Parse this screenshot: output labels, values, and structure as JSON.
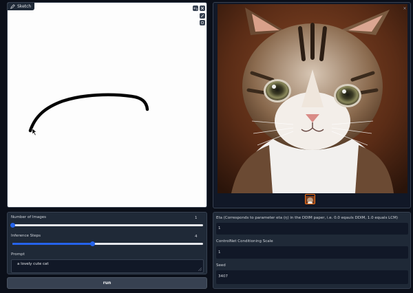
{
  "sketch": {
    "label": "Sketch"
  },
  "output": {
    "image_description": "cat-photo",
    "thumbnail": "cat-thumbnail"
  },
  "controls": {
    "num_images": {
      "label": "Number of Images",
      "value": "1",
      "fraction": 0.0
    },
    "inference_steps": {
      "label": "Inference Steps",
      "value": "4",
      "fraction": 0.42
    },
    "prompt": {
      "label": "Prompt",
      "value": "a lovely cute cat"
    }
  },
  "run_button": {
    "label": "run"
  },
  "right_controls": {
    "eta": {
      "label": "Eta (Corresponds to parameter eta (η) in the DDIM paper, i.e. 0.0 eqauls DDIM, 1.0 equals LCM)",
      "value": "1"
    },
    "controlnet": {
      "label": "ControlNet Conditioning Scale",
      "value": "1"
    },
    "seed": {
      "label": "Seed",
      "value": "3407"
    }
  },
  "colors": {
    "accent": "#2563eb",
    "thumbnail_border": "#f97316"
  }
}
